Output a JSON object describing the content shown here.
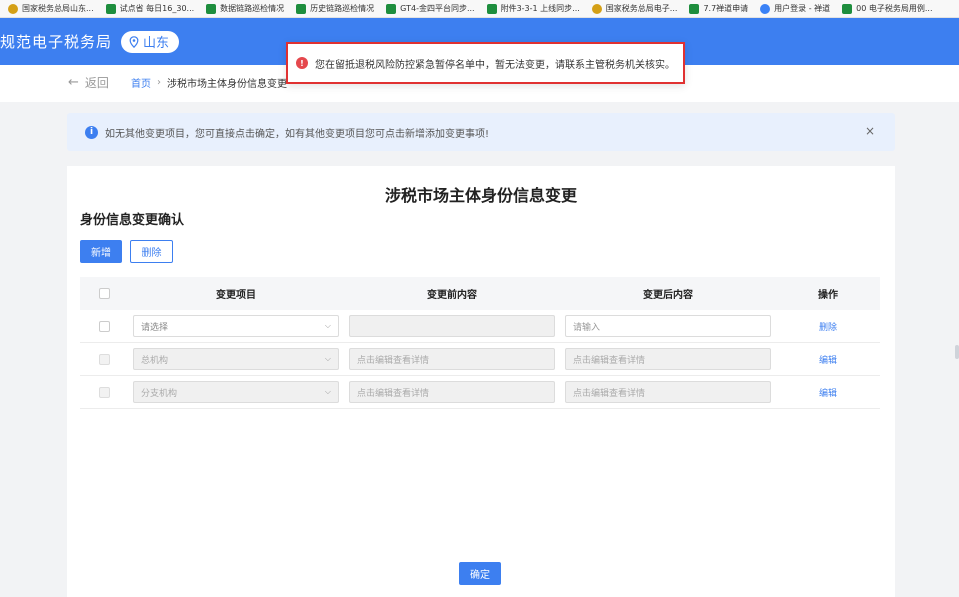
{
  "bookmarks": [
    {
      "icon": "seal-icon",
      "label": "国家税务总局山东..."
    },
    {
      "icon": "sheet-icon",
      "label": "试点省 每日16_30..."
    },
    {
      "icon": "sheet-icon",
      "label": "数据链路巡检情况"
    },
    {
      "icon": "sheet-icon",
      "label": "历史链路巡检情况"
    },
    {
      "icon": "sheet-icon",
      "label": "GT4-金四平台同步..."
    },
    {
      "icon": "sheet-icon",
      "label": "附件3-3-1 上线同步..."
    },
    {
      "icon": "seal-icon",
      "label": "国家税务总局电子..."
    },
    {
      "icon": "sheet-icon",
      "label": "7.7禅道申请"
    },
    {
      "icon": "globe-icon",
      "label": "用户登录 - 禅道"
    },
    {
      "icon": "sheet-icon",
      "label": "00 电子税务局用例..."
    }
  ],
  "header": {
    "site_title": "规范电子税务局",
    "region": "山东"
  },
  "subheader": {
    "back_label": "返回",
    "breadcrumb_home": "首页",
    "breadcrumb_separator": "›",
    "breadcrumb_current": "涉税市场主体身份信息变更"
  },
  "info_banner": {
    "text": "如无其他变更项目，您可直接点击确定，如有其他变更项目您可点击新增添加变更事项!",
    "close_symbol": "×"
  },
  "toast": {
    "message": "您在留抵退税风险防控紧急暂停名单中，暂无法变更，请联系主管税务机关核实。"
  },
  "main": {
    "page_title": "涉税市场主体身份信息变更",
    "section_title": "身份信息变更确认",
    "add_button": "新增",
    "delete_button": "删除",
    "confirm_button": "确定"
  },
  "table": {
    "headers": {
      "item": "变更项目",
      "before": "变更前内容",
      "after": "变更后内容",
      "action": "操作"
    },
    "rows": [
      {
        "item": "请选择",
        "item_disabled": false,
        "before": "",
        "after": "请输入",
        "after_disabled": false,
        "action": "删除"
      },
      {
        "item": "总机构",
        "item_disabled": true,
        "before": "点击编辑查看详情",
        "after": "点击编辑查看详情",
        "after_disabled": true,
        "action": "编辑"
      },
      {
        "item": "分支机构",
        "item_disabled": true,
        "before": "点击编辑查看详情",
        "after": "点击编辑查看详情",
        "after_disabled": true,
        "action": "编辑"
      }
    ]
  },
  "colors": {
    "primary": "#3d7ff0",
    "banner_bg": "#e8f0fd",
    "toast_border": "#e03131",
    "error": "#e5484d"
  }
}
